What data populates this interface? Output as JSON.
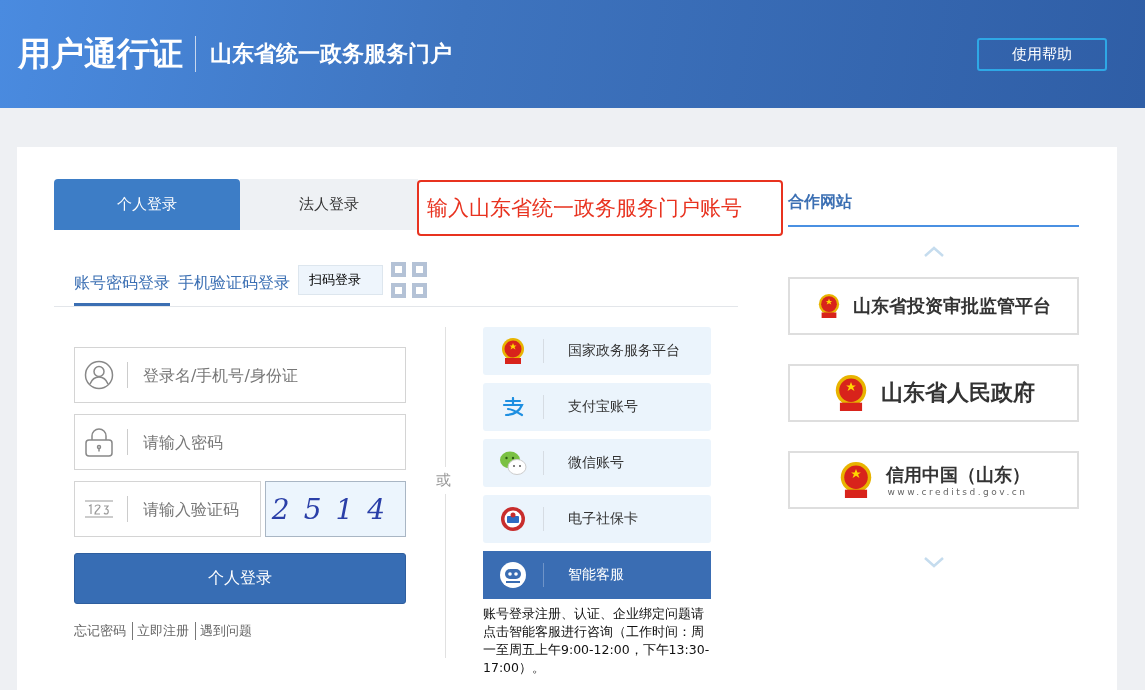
{
  "header": {
    "title": "用户通行证",
    "subtitle": "山东省统一政务服务门户",
    "help_button": "使用帮助"
  },
  "login_tabs": [
    {
      "label": "个人登录",
      "selected": true
    },
    {
      "label": "法人登录",
      "selected": false
    }
  ],
  "callout": "输入山东省统一政务服务门户账号",
  "method_tabs": [
    {
      "label": "账号密码登录",
      "selected": true
    },
    {
      "label": "手机验证码登录",
      "selected": false
    }
  ],
  "qr_login": "扫码登录",
  "fields": [
    {
      "kind": "user",
      "placeholder": "登录名/手机号/身份证"
    },
    {
      "kind": "lock",
      "placeholder": "请输入密码"
    },
    {
      "kind": "code",
      "placeholder": "请输入验证码"
    }
  ],
  "captcha": "2514",
  "login_button": "个人登录",
  "links": [
    "忘记密码",
    "立即注册",
    "遇到问题"
  ],
  "or_label": "或",
  "third_party": [
    {
      "kind": "emblem",
      "label": "国家政务服务平台",
      "highlighted": false
    },
    {
      "kind": "alipay",
      "label": "支付宝账号",
      "highlighted": false
    },
    {
      "kind": "wechat",
      "label": "微信账号",
      "highlighted": false
    },
    {
      "kind": "social-card",
      "label": "电子社保卡",
      "highlighted": false
    },
    {
      "kind": "robot",
      "label": "智能客服",
      "highlighted": true
    }
  ],
  "service_note": "账号登录注册、认证、企业绑定问题请点击智能客服进行咨询（工作时间：周一至周五上午9:00-12:00，下午13:30-17:00）。",
  "partners": {
    "heading": "合作网站",
    "items": [
      {
        "name": "山东省投资审批监管平台",
        "kind": "compact"
      },
      {
        "name": "山东省人民政府",
        "kind": "large"
      },
      {
        "name": "信用中国（山东）",
        "kind": "with-url",
        "url": "www.creditsd.gov.cn"
      }
    ]
  }
}
